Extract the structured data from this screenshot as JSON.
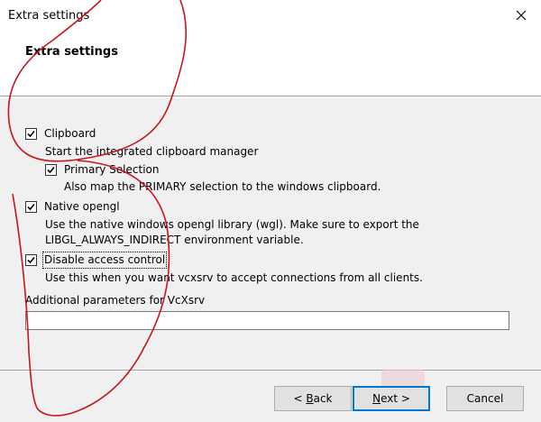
{
  "window": {
    "title": "Extra settings"
  },
  "header": {
    "title": "Extra settings"
  },
  "options": {
    "clipboard": {
      "label": "Clipboard",
      "checked": true,
      "description": "Start the integrated clipboard manager"
    },
    "primary_selection": {
      "label": "Primary Selection",
      "checked": true,
      "description": "Also map the PRIMARY selection to the windows clipboard."
    },
    "native_opengl": {
      "label": "Native opengl",
      "checked": true,
      "description_line1": "Use the native windows opengl library (wgl). Make sure to export the",
      "description_line2": "LIBGL_ALWAYS_INDIRECT environment variable."
    },
    "disable_access_control": {
      "label": "Disable access control",
      "checked": true,
      "description": "Use this when you want vcxsrv to accept connections from all clients."
    }
  },
  "additional_params": {
    "label": "Additional parameters for VcXsrv",
    "value": ""
  },
  "buttons": {
    "back": {
      "prefix": "< ",
      "mnemonic": "B",
      "rest": "ack"
    },
    "next": {
      "mnemonic": "N",
      "rest": "ext >"
    },
    "cancel": "Cancel"
  },
  "colors": {
    "accent": "#0078d7",
    "annotation": "#c8161d"
  },
  "icons": {
    "close": "close-icon",
    "checkmark": "checkmark-icon"
  }
}
